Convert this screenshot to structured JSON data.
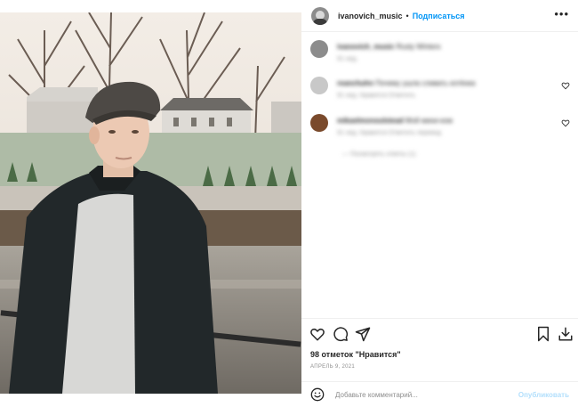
{
  "header": {
    "username": "ivanovich_music",
    "separator": "•",
    "follow_label": "Подписаться",
    "more_label": "•••"
  },
  "comments": [
    {
      "user": "ivanovich_music",
      "text": "Rusty Winters",
      "meta": "91 нед."
    },
    {
      "user": "reanchuhn",
      "text": "Почему ушла сливать котёнка",
      "meta": "91 нед.   Нравится   Ответить"
    },
    {
      "user": "mikaelmonoulstead",
      "text": "Мой мини-ком",
      "meta": "91 нед.   Нравится   Ответить перевод"
    }
  ],
  "replies_label": "—   Посмотреть ответы (1)",
  "actions": {
    "like_icon": "heart-icon",
    "comment_icon": "comment-icon",
    "share_icon": "share-icon",
    "save_icon": "bookmark-icon",
    "download_icon": "download-icon"
  },
  "likes": "98 отметок \"Нравится\"",
  "date": "АПРЕЛЬ 9, 2021",
  "add_comment": {
    "placeholder": "Добавьте комментарий...",
    "publish_label": "Опубликовать"
  }
}
